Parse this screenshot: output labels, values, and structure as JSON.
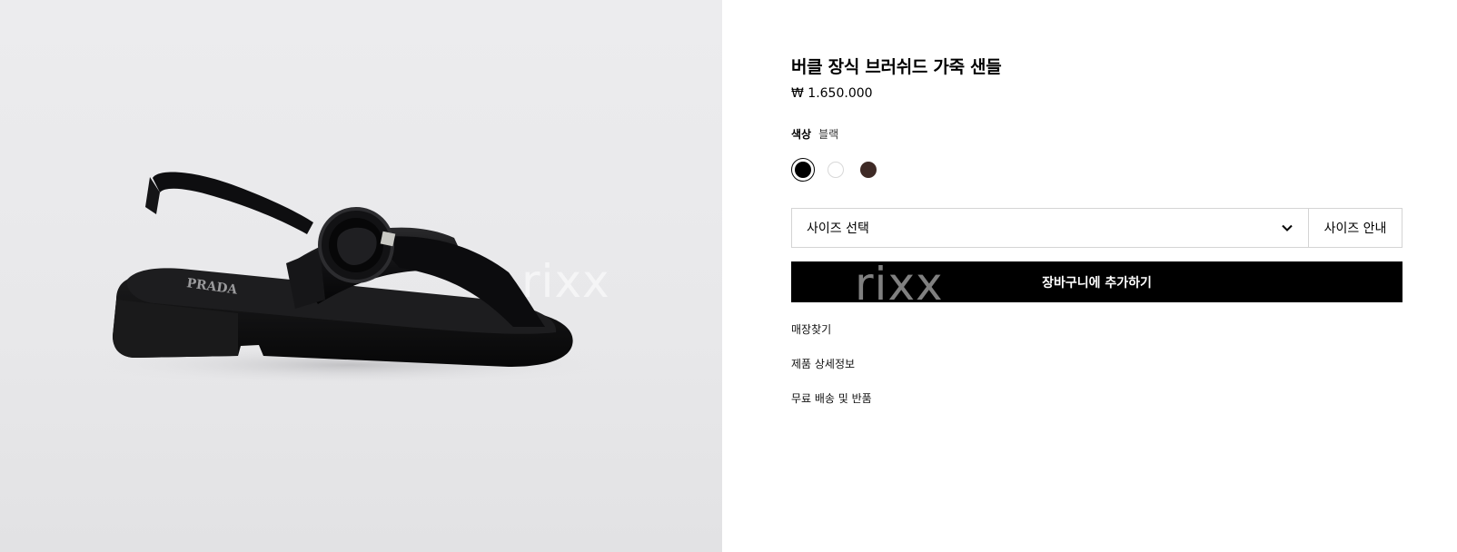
{
  "product": {
    "title": "버클 장식 브러쉬드 가죽 샌들",
    "price": "₩ 1.650.000",
    "color_label": "색상",
    "color_value": "블랙"
  },
  "colors": {
    "swatches": [
      {
        "name": "black",
        "hex": "#000000",
        "selected": true
      },
      {
        "name": "white",
        "hex": "#ffffff",
        "selected": false
      },
      {
        "name": "brown",
        "hex": "#3e2a26",
        "selected": false
      }
    ]
  },
  "size": {
    "select_label": "사이즈 선택",
    "guide_label": "사이즈 안내"
  },
  "cart": {
    "add_label": "장바구니에 추가하기"
  },
  "links": {
    "store_finder": "매장찾기",
    "details": "제품 상세정보",
    "shipping": "무료 배송 및 반품"
  },
  "watermark": {
    "text": "rixx"
  },
  "image": {
    "logo_text": "PRADA"
  },
  "theme": {
    "accent": "#000000",
    "background_image": "#e8e8ea"
  }
}
